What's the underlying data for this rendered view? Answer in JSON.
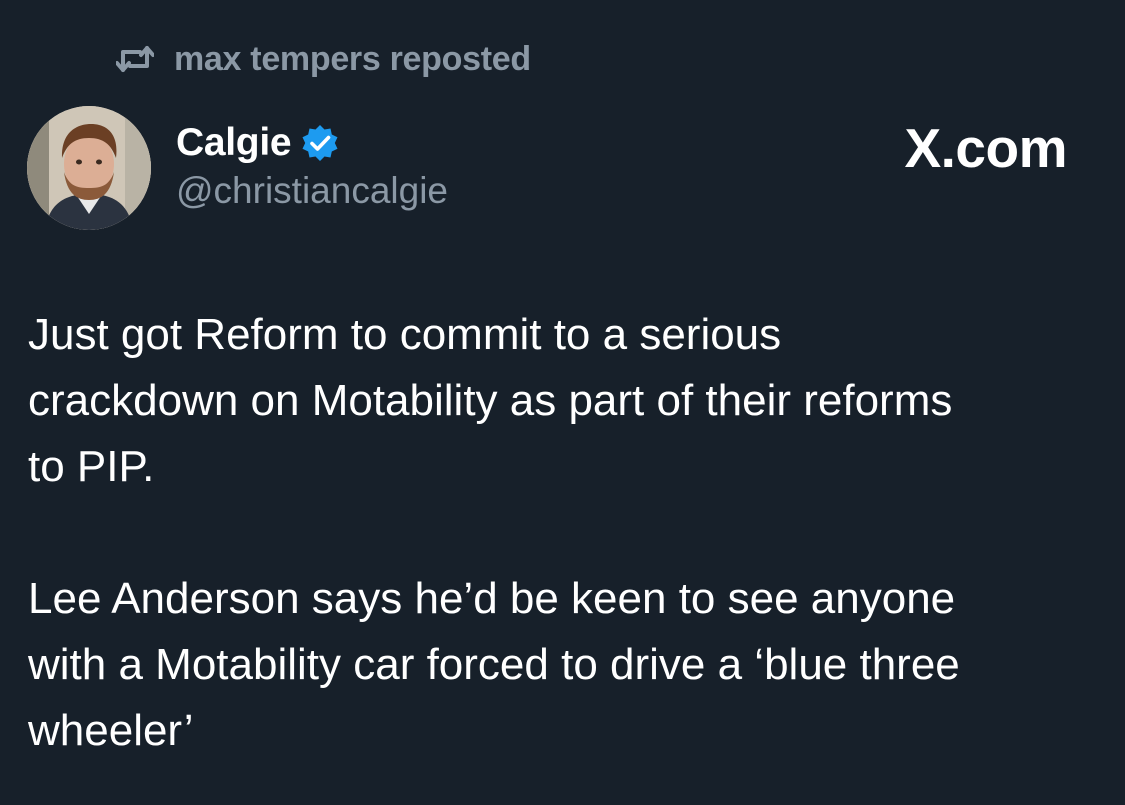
{
  "repost": {
    "icon": "repost-icon",
    "text": "max tempers reposted"
  },
  "author": {
    "avatar_icon": "profile-photo",
    "display_name": "Calgie",
    "verified_icon": "verified-badge-icon",
    "verified_color": "#1d9bf0",
    "handle": "@christiancalgie"
  },
  "source": {
    "label": "X.com"
  },
  "post": {
    "paragraphs": [
      "Just got Reform to commit to a serious\ncrackdown on Motability as part of their reforms\nto PIP.",
      "Lee Anderson says he’d be keen to see anyone\nwith a Motability car forced to drive a ‘blue three\nwheeler’"
    ]
  },
  "colors": {
    "background": "#17202a",
    "primary_text": "#ffffff",
    "secondary_text": "#8b98a5",
    "accent": "#1d9bf0"
  }
}
